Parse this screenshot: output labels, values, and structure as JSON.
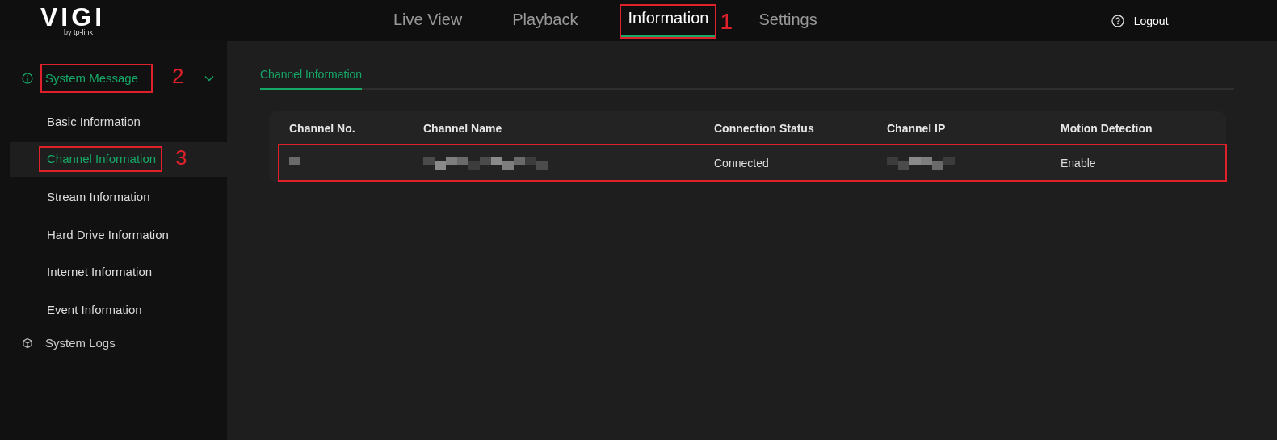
{
  "logo": {
    "name": "VIGI",
    "tagline": "by tp-link"
  },
  "nav": [
    {
      "label": "Live View",
      "selected": false
    },
    {
      "label": "Playback",
      "selected": false
    },
    {
      "label": "Information",
      "selected": true,
      "annotation": "1"
    },
    {
      "label": "Settings",
      "selected": false
    }
  ],
  "logout": {
    "label": "Logout"
  },
  "sidebar": {
    "items": [
      {
        "label": "System Message",
        "kind": "info",
        "expanded": true,
        "selected": true,
        "annotation": "2",
        "children": [
          {
            "label": "Basic Information",
            "selected": false
          },
          {
            "label": "Channel Information",
            "selected": true,
            "annotation": "3"
          },
          {
            "label": "Stream Information",
            "selected": false
          },
          {
            "label": "Hard Drive Information",
            "selected": false
          },
          {
            "label": "Internet Information",
            "selected": false
          },
          {
            "label": "Event Information",
            "selected": false
          }
        ]
      },
      {
        "label": "System Logs",
        "kind": "logs",
        "selected": false
      }
    ]
  },
  "subtabs": [
    {
      "label": "Channel Information",
      "selected": true
    }
  ],
  "table": {
    "columns": [
      "Channel No.",
      "Channel Name",
      "Connection Status",
      "Channel IP",
      "Motion Detection"
    ],
    "rows": [
      {
        "annotated": true,
        "cells": [
          {
            "kind": "redacted"
          },
          {
            "kind": "redacted"
          },
          {
            "kind": "text",
            "text": "Connected"
          },
          {
            "kind": "redacted"
          },
          {
            "kind": "text",
            "text": "Enable"
          }
        ]
      }
    ]
  }
}
